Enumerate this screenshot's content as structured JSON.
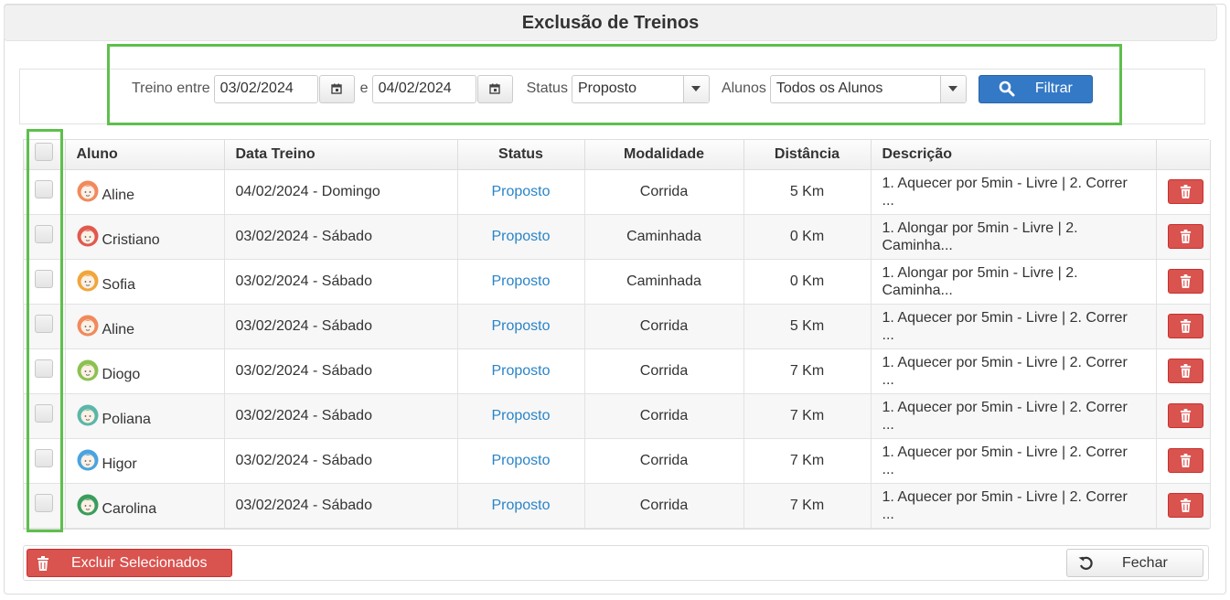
{
  "title": "Exclusão de Treinos",
  "filter": {
    "label_between": "Treino entre",
    "date_from": "03/02/2024",
    "label_and": "e",
    "date_to": "04/02/2024",
    "label_status": "Status",
    "status_value": "Proposto",
    "label_students": "Alunos",
    "students_value": "Todos os Alunos",
    "filter_button": "Filtrar"
  },
  "table": {
    "headers": {
      "aluno": "Aluno",
      "data": "Data Treino",
      "status": "Status",
      "modalidade": "Modalidade",
      "distancia": "Distância",
      "descricao": "Descrição"
    },
    "rows": [
      {
        "aluno": "Aline",
        "data": "04/02/2024 - Domingo",
        "status": "Proposto",
        "modalidade": "Corrida",
        "distancia": "5 Km",
        "desc1": "1. Aquecer por 5min - Livre | 2. Correr",
        "desc2": "...",
        "avatar_color": "#f08a5d"
      },
      {
        "aluno": "Cristiano",
        "data": "03/02/2024 - Sábado",
        "status": "Proposto",
        "modalidade": "Caminhada",
        "distancia": "0 Km",
        "desc1": "1. Alongar por 5min - Livre | 2.",
        "desc2": "Caminha...",
        "avatar_color": "#e05a4e"
      },
      {
        "aluno": "Sofia",
        "data": "03/02/2024 - Sábado",
        "status": "Proposto",
        "modalidade": "Caminhada",
        "distancia": "0 Km",
        "desc1": "1. Alongar por 5min - Livre | 2.",
        "desc2": "Caminha...",
        "avatar_color": "#f0a63c"
      },
      {
        "aluno": "Aline",
        "data": "03/02/2024 - Sábado",
        "status": "Proposto",
        "modalidade": "Corrida",
        "distancia": "5 Km",
        "desc1": "1. Aquecer por 5min - Livre | 2. Correr",
        "desc2": "...",
        "avatar_color": "#f08a5d"
      },
      {
        "aluno": "Diogo",
        "data": "03/02/2024 - Sábado",
        "status": "Proposto",
        "modalidade": "Corrida",
        "distancia": "7 Km",
        "desc1": "1. Aquecer por 5min - Livre | 2. Correr",
        "desc2": "...",
        "avatar_color": "#8cc152"
      },
      {
        "aluno": "Poliana",
        "data": "03/02/2024 - Sábado",
        "status": "Proposto",
        "modalidade": "Corrida",
        "distancia": "7 Km",
        "desc1": "1. Aquecer por 5min - Livre | 2. Correr",
        "desc2": "...",
        "avatar_color": "#5bb7a8"
      },
      {
        "aluno": "Higor",
        "data": "03/02/2024 - Sábado",
        "status": "Proposto",
        "modalidade": "Corrida",
        "distancia": "7 Km",
        "desc1": "1. Aquecer por 5min - Livre | 2. Correr",
        "desc2": "...",
        "avatar_color": "#4aa3df"
      },
      {
        "aluno": "Carolina",
        "data": "03/02/2024 - Sábado",
        "status": "Proposto",
        "modalidade": "Corrida",
        "distancia": "7 Km",
        "desc1": "1. Aquecer por 5min - Livre | 2. Correr",
        "desc2": "...",
        "avatar_color": "#3a9d5d"
      }
    ]
  },
  "footer": {
    "delete_selected": "Excluir Selecionados",
    "close": "Fechar"
  },
  "colors": {
    "primary": "#3479c6",
    "danger": "#d9534f",
    "status_link": "#2a84c8",
    "highlight": "#5ebf4d"
  }
}
